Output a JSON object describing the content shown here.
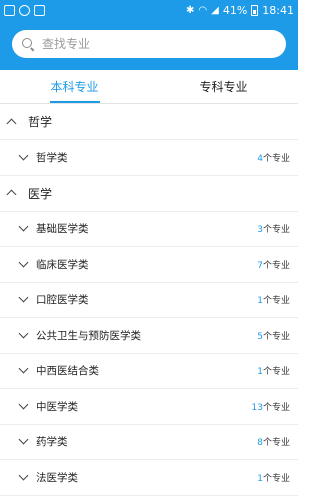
{
  "statusbar": {
    "battery": "41%",
    "time": "18:41"
  },
  "search": {
    "placeholder": "查找专业"
  },
  "tabs": [
    {
      "label": "本科专业",
      "active": true
    },
    {
      "label": "专科专业",
      "active": false
    }
  ],
  "groups": [
    {
      "title": "哲学",
      "items": [
        {
          "name": "哲学类",
          "count": "4",
          "unit": "个专业"
        }
      ]
    },
    {
      "title": "医学",
      "items": [
        {
          "name": "基础医学类",
          "count": "3",
          "unit": "个专业"
        },
        {
          "name": "临床医学类",
          "count": "7",
          "unit": "个专业"
        },
        {
          "name": "口腔医学类",
          "count": "1",
          "unit": "个专业"
        },
        {
          "name": "公共卫生与预防医学类",
          "count": "5",
          "unit": "个专业"
        },
        {
          "name": "中西医结合类",
          "count": "1",
          "unit": "个专业"
        },
        {
          "name": "中医学类",
          "count": "13",
          "unit": "个专业"
        },
        {
          "name": "药学类",
          "count": "8",
          "unit": "个专业"
        },
        {
          "name": "法医学类",
          "count": "1",
          "unit": "个专业"
        }
      ]
    }
  ],
  "colors": {
    "accent": "#1e9be8"
  }
}
